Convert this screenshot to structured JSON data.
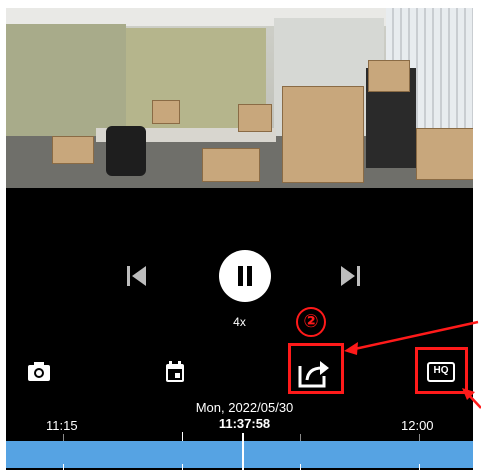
{
  "player": {
    "speed_label": "4x",
    "date_label": "Mon, 2022/05/30",
    "current_time": "11:37:58",
    "timeline_ticks": [
      "11:15",
      "12:00"
    ]
  },
  "toolbar": {
    "icons": [
      "camera-icon",
      "calendar-icon",
      "share-icon",
      "hq-icon"
    ],
    "hq_label": "HQ"
  },
  "annotation": {
    "step_number": "②",
    "highlight_color": "#ff1a1a"
  },
  "colors": {
    "timeline": "#56a3e3",
    "background": "#000000"
  }
}
